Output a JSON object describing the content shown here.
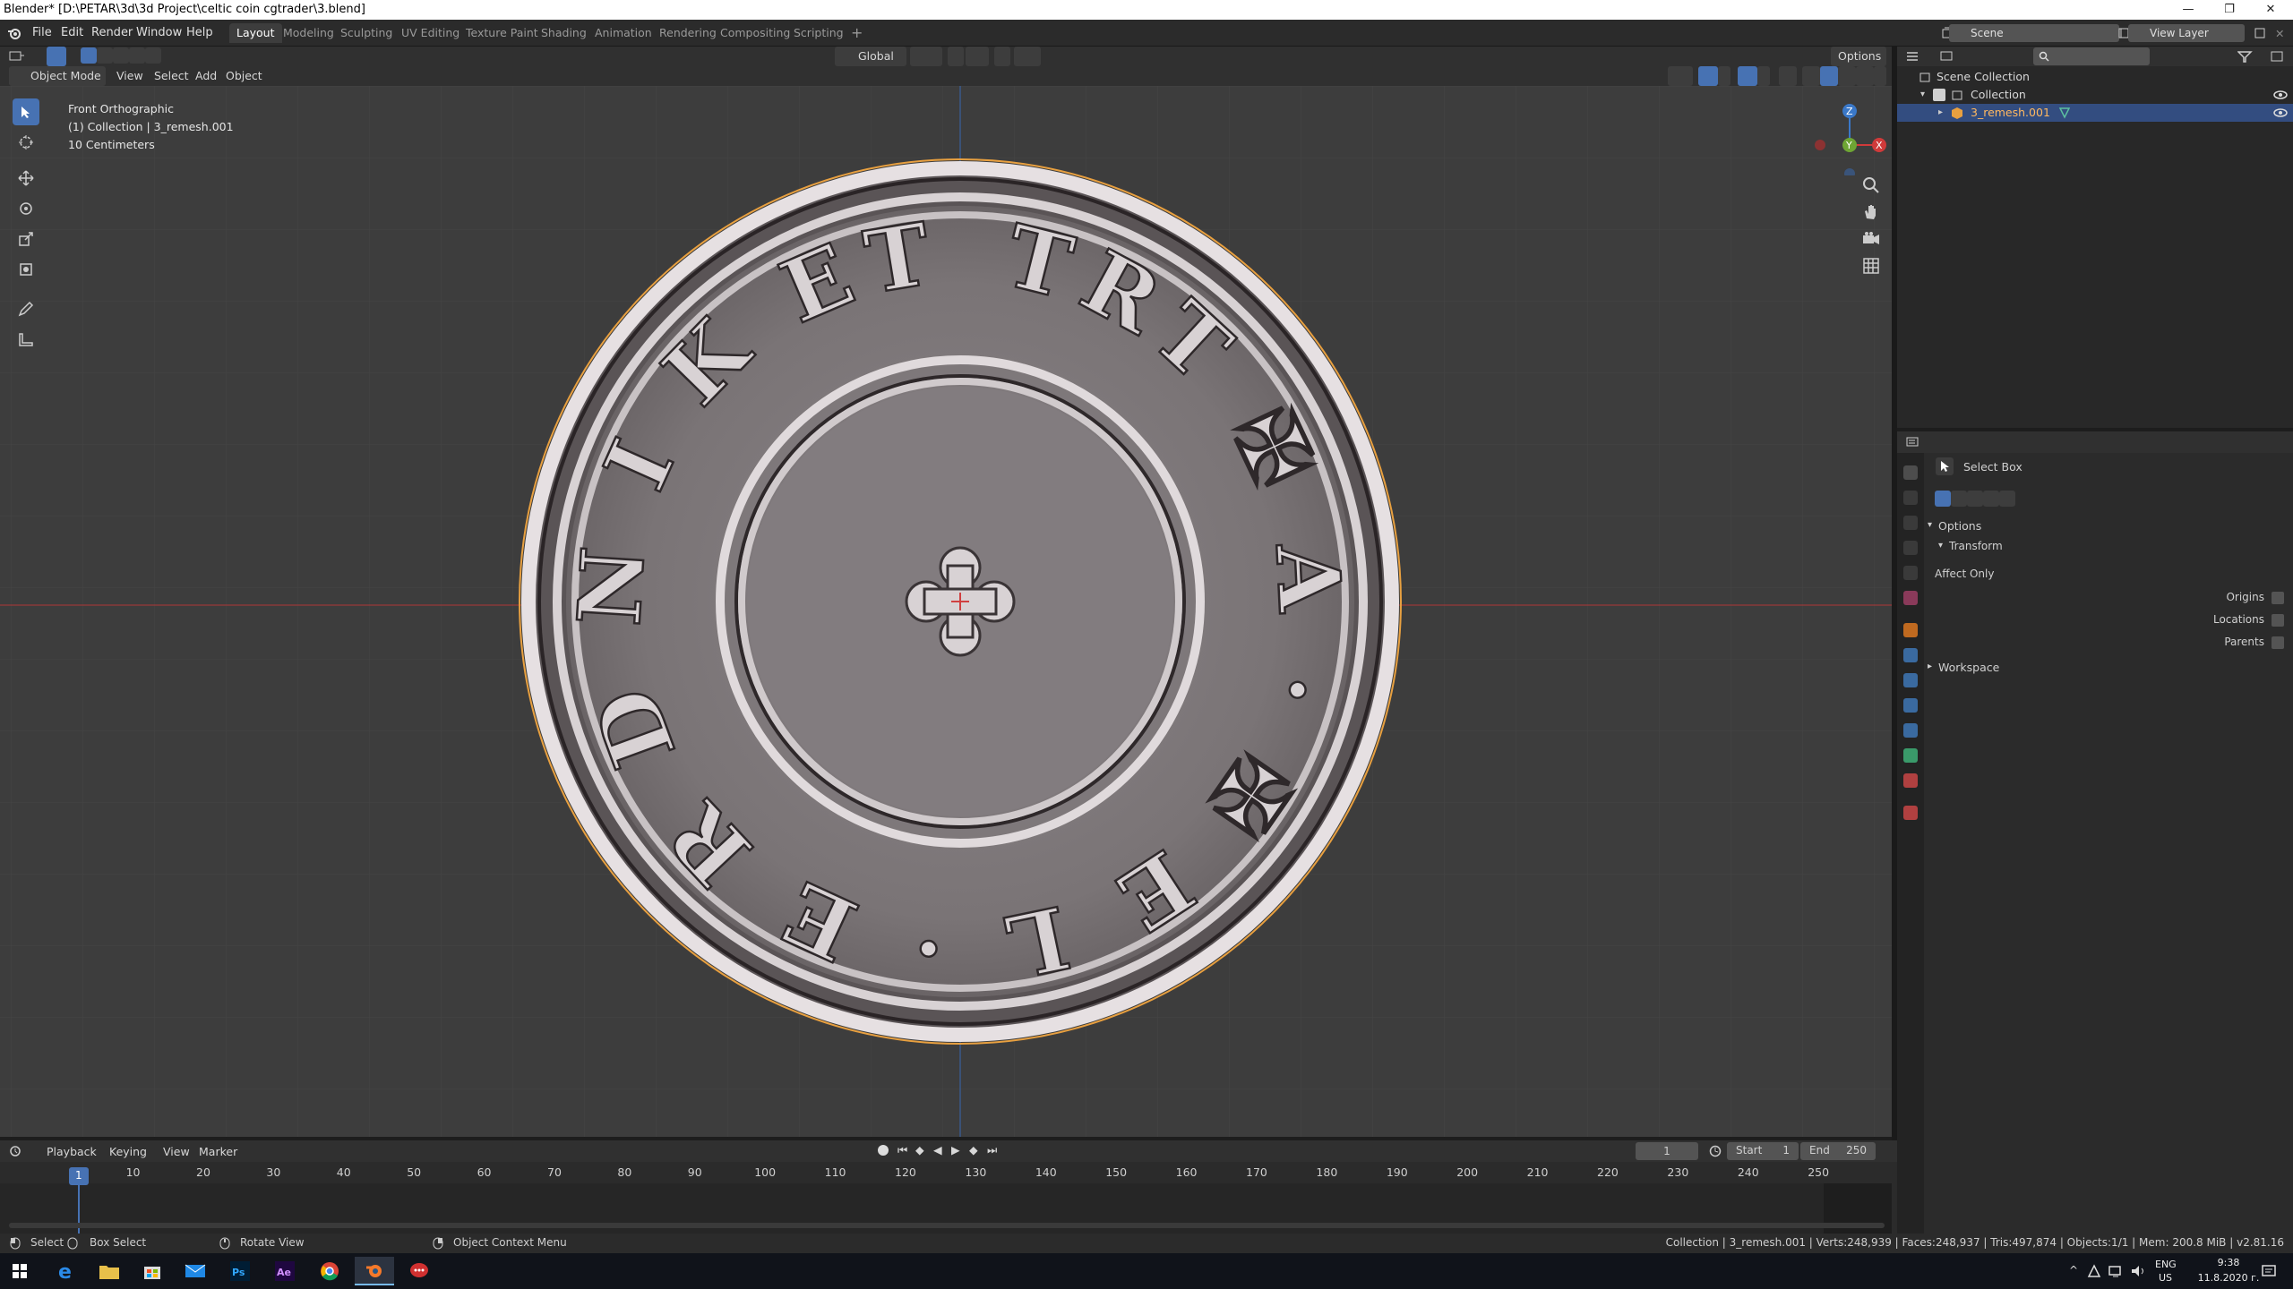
{
  "window": {
    "title": "Blender* [D:\\PETAR\\3d\\3d Project\\celtic coin cgtrader\\3.blend]",
    "controls": [
      "—",
      "❐",
      "✕"
    ]
  },
  "menu": {
    "items": [
      "File",
      "Edit",
      "Render",
      "Window",
      "Help"
    ],
    "workspace_tabs": [
      "Layout",
      "Modeling",
      "Sculpting",
      "UV Editing",
      "Texture Paint",
      "Shading",
      "Animation",
      "Rendering",
      "Compositing",
      "Scripting"
    ],
    "active_tab": "Layout",
    "add_tab": "+",
    "scene_label": "Scene",
    "view_layer_label": "View Layer"
  },
  "viewport_header": {
    "transform_orientation": "Global",
    "options_label": "Options",
    "mode": "Object Mode",
    "menus": [
      "View",
      "Select",
      "Add",
      "Object"
    ]
  },
  "viewport": {
    "view_name": "Front Orthographic",
    "collection_info": "(1) Collection | 3_remesh.001",
    "scale_info": "10 Centimeters",
    "gizmo_axes": [
      "Z",
      "Y",
      "X"
    ],
    "coin_inscription": "TRT ✠ A · ✠ E L · E R D N I K ET"
  },
  "outliner": {
    "search_placeholder": "",
    "rows": [
      {
        "label": "Scene Collection"
      },
      {
        "label": "Collection"
      },
      {
        "label": "3_remesh.001"
      }
    ]
  },
  "properties": {
    "tool_name": "Select Box",
    "options_label": "Options",
    "transform_label": "Transform",
    "affect_only_label": "Affect Only",
    "checkboxes": [
      "Origins",
      "Locations",
      "Parents"
    ],
    "workspace_label": "Workspace"
  },
  "timeline": {
    "menus": [
      "Playback",
      "Keying",
      "View",
      "Marker"
    ],
    "current_frame": "1",
    "start_label": "Start",
    "start_value": "1",
    "end_label": "End",
    "end_value": "250",
    "frames": [
      "1",
      "10",
      "20",
      "30",
      "40",
      "50",
      "60",
      "70",
      "80",
      "90",
      "100",
      "110",
      "120",
      "130",
      "140",
      "150",
      "160",
      "170",
      "180",
      "190",
      "200",
      "210",
      "220",
      "230",
      "240",
      "250"
    ]
  },
  "statusbar": {
    "select": "Select",
    "box_select": "Box Select",
    "rotate_view": "Rotate View",
    "context_menu": "Object Context Menu",
    "stats": "Collection | 3_remesh.001 | Verts:248,939 | Faces:248,937 | Tris:497,874 | Objects:1/1 | Mem: 200.8 MiB | v2.81.16"
  },
  "taskbar": {
    "lang": "ENG",
    "region": "US",
    "time": "9:38",
    "date": "11.8.2020 г."
  },
  "colors": {
    "accent": "#4772b3",
    "selection": "#334d80",
    "object_outline": "#e8a040",
    "x_axis": "#d03a3a",
    "y_axis": "#6ea534",
    "z_axis": "#3a78c8"
  }
}
